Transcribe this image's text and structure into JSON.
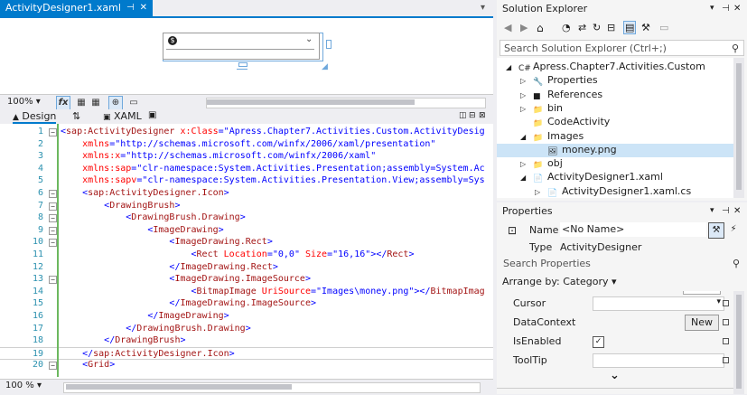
{
  "doc_tab": {
    "title": "ActivityDesigner1.xaml",
    "pin": "⊣",
    "close": "✕"
  },
  "designer": {
    "badge": "$"
  },
  "zoom_top": "100%",
  "split": {
    "design": "Design",
    "swap": "⇅",
    "xaml": "XAML"
  },
  "code_lines": [
    {
      "n": "1",
      "text": "<sap:ActivityDesigner x:Class=\"Apress.Chapter7.Activities.Custom.ActivityDesig"
    },
    {
      "n": "2",
      "text": "    xmlns=\"http://schemas.microsoft.com/winfx/2006/xaml/presentation\""
    },
    {
      "n": "3",
      "text": "    xmlns:x=\"http://schemas.microsoft.com/winfx/2006/xaml\""
    },
    {
      "n": "4",
      "text": "    xmlns:sap=\"clr-namespace:System.Activities.Presentation;assembly=System.Ac"
    },
    {
      "n": "5",
      "text": "    xmlns:sapv=\"clr-namespace:System.Activities.Presentation.View;assembly=Sys"
    },
    {
      "n": "6",
      "text": "    <sap:ActivityDesigner.Icon>"
    },
    {
      "n": "7",
      "text": "        <DrawingBrush>"
    },
    {
      "n": "8",
      "text": "            <DrawingBrush.Drawing>"
    },
    {
      "n": "9",
      "text": "                <ImageDrawing>"
    },
    {
      "n": "10",
      "text": "                    <ImageDrawing.Rect>"
    },
    {
      "n": "11",
      "text": "                        <Rect Location=\"0,0\" Size=\"16,16\"></Rect>"
    },
    {
      "n": "12",
      "text": "                    </ImageDrawing.Rect>"
    },
    {
      "n": "13",
      "text": "                    <ImageDrawing.ImageSource>"
    },
    {
      "n": "14",
      "text": "                        <BitmapImage UriSource=\"Images\\money.png\"></BitmapImag"
    },
    {
      "n": "15",
      "text": "                    </ImageDrawing.ImageSource>"
    },
    {
      "n": "16",
      "text": "                </ImageDrawing>"
    },
    {
      "n": "17",
      "text": "            </DrawingBrush.Drawing>"
    },
    {
      "n": "18",
      "text": "        </DrawingBrush>"
    },
    {
      "n": "19",
      "text": "    </sap:ActivityDesigner.Icon>"
    },
    {
      "n": "20",
      "text": "    <Grid>"
    }
  ],
  "zoom_bottom": "100 %",
  "solution_explorer": {
    "title": "Solution Explorer",
    "search_placeholder": "Search Solution Explorer (Ctrl+;)",
    "items": [
      {
        "label": "Apress.Chapter7.Activities.Custom",
        "indent": 0,
        "expander": "◢",
        "icon": "C#"
      },
      {
        "label": "Properties",
        "indent": 1,
        "expander": "▷",
        "icon": "🔧"
      },
      {
        "label": "References",
        "indent": 1,
        "expander": "▷",
        "icon": "■"
      },
      {
        "label": "bin",
        "indent": 1,
        "expander": "▷",
        "icon": "📁"
      },
      {
        "label": "CodeActivity",
        "indent": 1,
        "expander": "",
        "icon": "📁"
      },
      {
        "label": "Images",
        "indent": 1,
        "expander": "◢",
        "icon": "📁"
      },
      {
        "label": "money.png",
        "indent": 2,
        "expander": "",
        "icon": "🖼"
      },
      {
        "label": "obj",
        "indent": 1,
        "expander": "▷",
        "icon": "📁"
      },
      {
        "label": "ActivityDesigner1.xaml",
        "indent": 1,
        "expander": "◢",
        "icon": "📄"
      },
      {
        "label": "ActivityDesigner1.xaml.cs",
        "indent": 2,
        "expander": "▷",
        "icon": "📄"
      }
    ]
  },
  "properties": {
    "title": "Properties",
    "name_label": "Name",
    "name_value": "<No Name>",
    "type_label": "Type",
    "type_value": "ActivityDesigner",
    "search_placeholder": "Search Properties",
    "arrange_by": "Arrange by: Category",
    "rows": [
      {
        "label": "Cursor"
      },
      {
        "label": "DataContext",
        "button": "New"
      },
      {
        "label": "IsEnabled",
        "checked": "✓"
      },
      {
        "label": "ToolTip"
      }
    ],
    "expand_glyph": "⌄"
  }
}
